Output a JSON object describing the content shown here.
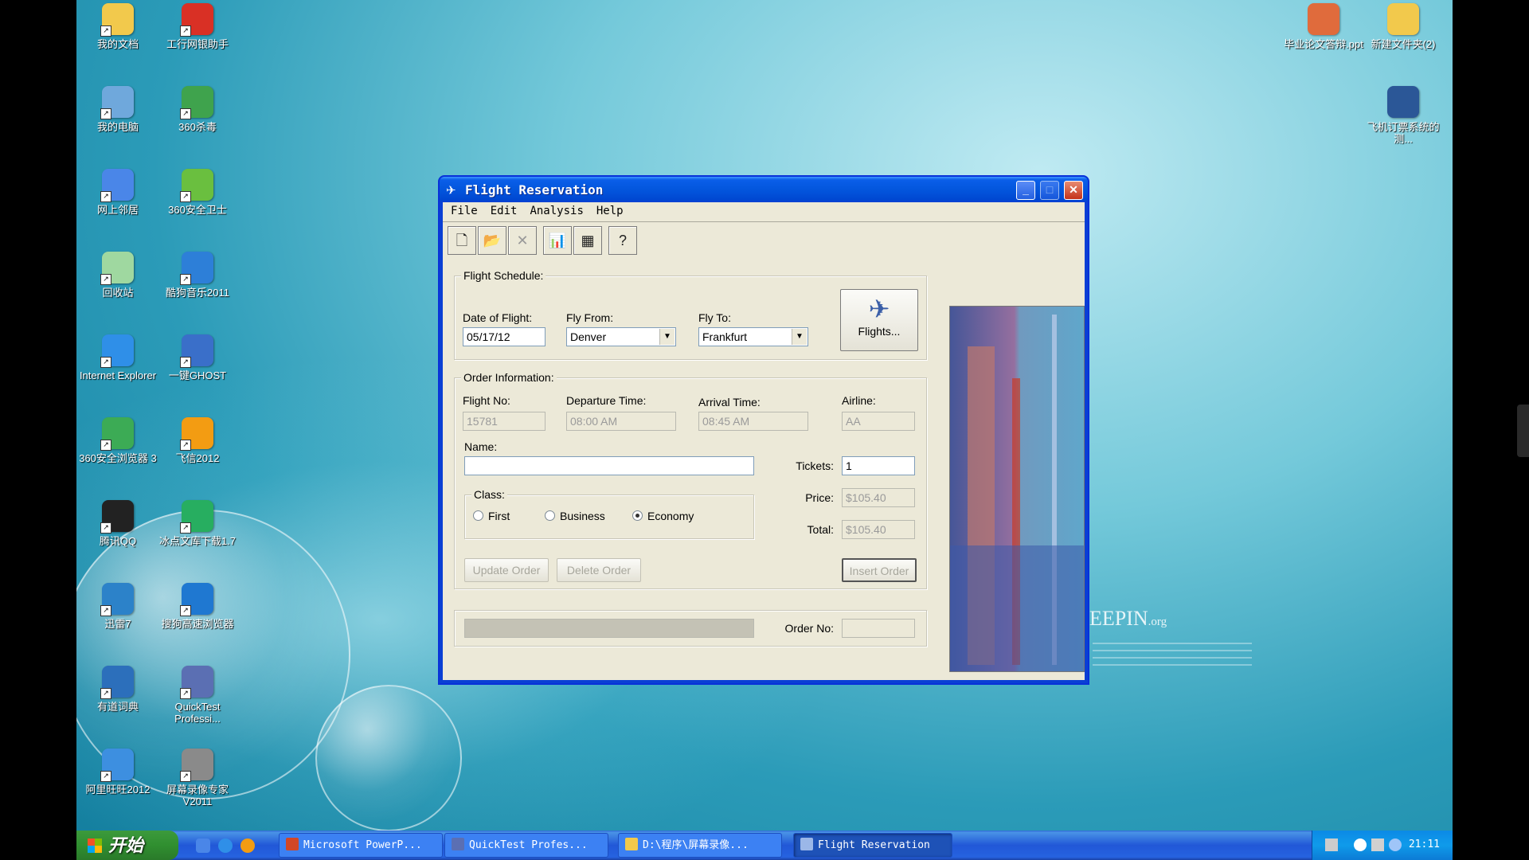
{
  "desktop": {
    "left_icons": [
      {
        "label": "我的文档",
        "color": "#f2c94c"
      },
      {
        "label": "工行网银助手",
        "color": "#d93025"
      },
      {
        "label": "我的电脑",
        "color": "#6fa8dc"
      },
      {
        "label": "360杀毒",
        "color": "#3fa34d"
      },
      {
        "label": "网上邻居",
        "color": "#4a86e8"
      },
      {
        "label": "360安全卫士",
        "color": "#6abf3f"
      },
      {
        "label": "回收站",
        "color": "#9fd8a0"
      },
      {
        "label": "酷狗音乐2011",
        "color": "#2d7fd8"
      },
      {
        "label": "Internet Explorer",
        "color": "#2f8fe8"
      },
      {
        "label": "一键GHOST",
        "color": "#3a6fc9"
      },
      {
        "label": "360安全浏览器 3",
        "color": "#3cab55"
      },
      {
        "label": "飞信2012",
        "color": "#f39c12"
      },
      {
        "label": "腾讯QQ",
        "color": "#222222"
      },
      {
        "label": "冰点文库下载1.7",
        "color": "#27ae60"
      },
      {
        "label": "迅雷7",
        "color": "#2c82c9"
      },
      {
        "label": "搜狗高速浏览器",
        "color": "#1f78d1"
      },
      {
        "label": "有道词典",
        "color": "#2c6fbb"
      },
      {
        "label": "QuickTest Professi...",
        "color": "#5b6fb3"
      },
      {
        "label": "阿里旺旺2012",
        "color": "#3d8fe0"
      },
      {
        "label": "屏幕录像专家V2011",
        "color": "#8a8a8a"
      }
    ],
    "right_icons": [
      {
        "label": "毕业论文答辩.ppt",
        "color": "#e06b3c"
      },
      {
        "label": "新建文件夹(2)",
        "color": "#f2c94c"
      },
      {
        "label": "飞机订票系统的测...",
        "color": "#2b5797"
      }
    ],
    "watermark": {
      "text": "EEPIN",
      "suffix": ".org"
    }
  },
  "window": {
    "title": "Flight Reservation",
    "menu": [
      "File",
      "Edit",
      "Analysis",
      "Help"
    ],
    "toolbar": [
      {
        "name": "new-order-icon",
        "glyph": "🗋",
        "enabled": true
      },
      {
        "name": "open-order-icon",
        "glyph": "📂",
        "enabled": true
      },
      {
        "name": "delete-order-icon",
        "glyph": "✕",
        "enabled": false
      },
      {
        "name": "graph-icon",
        "glyph": "📊",
        "enabled": true
      },
      {
        "name": "report-icon",
        "glyph": "▦",
        "enabled": true
      },
      {
        "name": "help-icon",
        "glyph": "?",
        "enabled": true
      }
    ],
    "schedule": {
      "group_label": "Flight Schedule:",
      "date_label": "Date of Flight:",
      "date_value": "05/17/12",
      "from_label": "Fly From:",
      "from_value": "Denver",
      "to_label": "Fly To:",
      "to_value": "Frankfurt",
      "flights_button": "Flights..."
    },
    "order": {
      "group_label": "Order Information:",
      "flight_no_label": "Flight No:",
      "flight_no_value": "15781",
      "departure_label": "Departure Time:",
      "departure_value": "08:00 AM",
      "arrival_label": "Arrival Time:",
      "arrival_value": "08:45 AM",
      "airline_label": "Airline:",
      "airline_value": "AA",
      "name_label": "Name:",
      "name_value": "",
      "tickets_label": "Tickets:",
      "tickets_value": "1",
      "class_label": "Class:",
      "class_options": [
        "First",
        "Business",
        "Economy"
      ],
      "class_selected": "Economy",
      "price_label": "Price:",
      "price_value": "$105.40",
      "total_label": "Total:",
      "total_value": "$105.40",
      "update_button": "Update Order",
      "delete_button": "Delete Order",
      "insert_button": "Insert Order"
    },
    "status": {
      "order_no_label": "Order No:",
      "order_no_value": ""
    }
  },
  "taskbar": {
    "start_label": "开始",
    "tasks": [
      {
        "label": "Microsoft PowerP...",
        "color": "#d24726",
        "active": false
      },
      {
        "label": "QuickTest Profes...",
        "color": "#5b6fb3",
        "active": false
      },
      {
        "label": "D:\\程序\\屏幕录像...",
        "color": "#f2c94c",
        "active": false
      },
      {
        "label": "Flight Reservation",
        "color": "#9bb7e8",
        "active": true
      }
    ],
    "clock": "21:11"
  }
}
